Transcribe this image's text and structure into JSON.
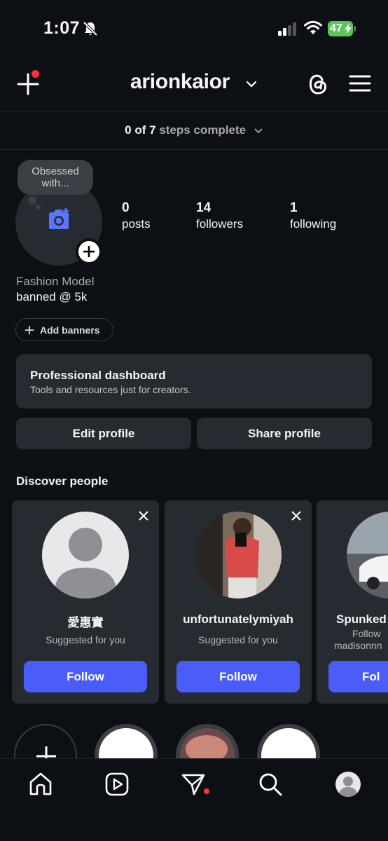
{
  "status_bar": {
    "time": "1:07",
    "battery": "47"
  },
  "header": {
    "username": "arionkaior"
  },
  "steps": {
    "done": "0",
    "of": "of",
    "total": "7",
    "label": "steps complete"
  },
  "profile": {
    "note": "Obsessed with...",
    "stats": [
      {
        "value": "0",
        "label": "posts"
      },
      {
        "value": "14",
        "label": "followers"
      },
      {
        "value": "1",
        "label": "following"
      }
    ],
    "category": "Fashion Model",
    "bio": "banned @ 5k",
    "add_banners": "Add banners"
  },
  "pro_dashboard": {
    "title": "Professional dashboard",
    "subtitle": "Tools and resources just for creators."
  },
  "actions": {
    "edit": "Edit profile",
    "share": "Share profile"
  },
  "discover": {
    "title": "Discover people",
    "cards": [
      {
        "name": "愛惠實",
        "subtitle": "Suggested for you",
        "follow": "Follow"
      },
      {
        "name": "unfortunatelymiyah",
        "subtitle": "Suggested for you",
        "follow": "Follow"
      },
      {
        "name": "Spunked",
        "subtitle": "Follow",
        "subtitle2": "madisonnn",
        "follow": "Fol"
      }
    ]
  },
  "colors": {
    "background": "#0c1014",
    "card": "#262a31",
    "accent": "#4a5df9",
    "notification": "#ff3040",
    "battery": "#5ec25d"
  },
  "nav": {
    "icons": [
      "home-icon",
      "reels-icon",
      "direct-icon",
      "search-icon",
      "profile-avatar"
    ]
  }
}
